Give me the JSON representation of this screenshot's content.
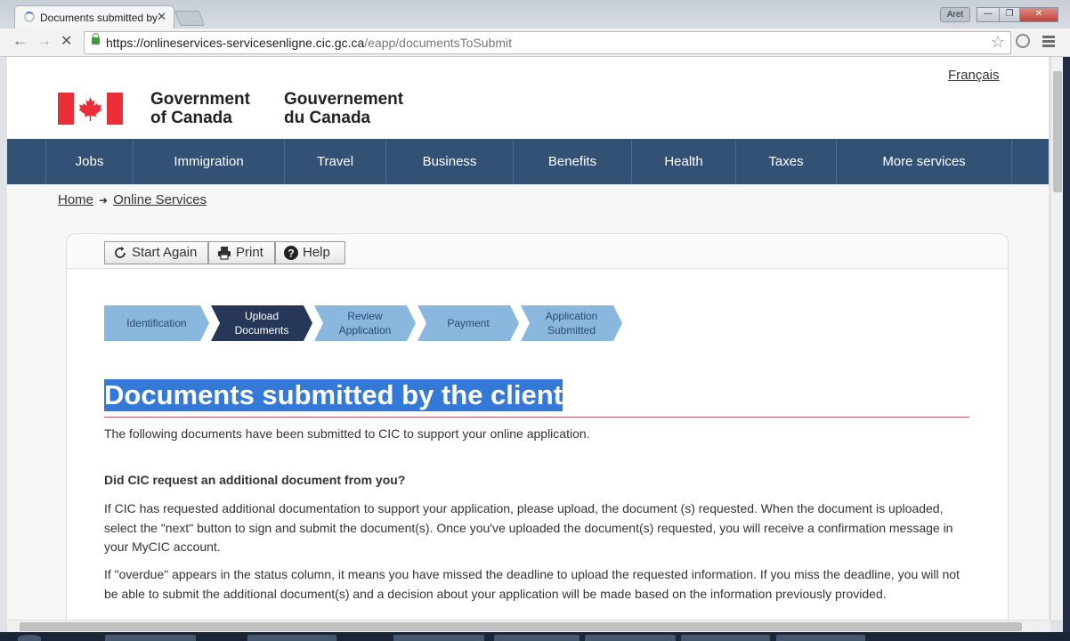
{
  "browser": {
    "tab_title": "Documents submitted by",
    "tab_close": "✕",
    "user_badge": "Aret",
    "url_host": "https://onlineservices-servicesenligne.cic.gc.ca",
    "url_path": "/eapp/documentsToSubmit"
  },
  "header": {
    "language_link": "Français",
    "gov_en_line1": "Government",
    "gov_en_line2": "of Canada",
    "gov_fr_line1": "Gouvernement",
    "gov_fr_line2": "du Canada",
    "flag_colors": {
      "red": "#eb2d37",
      "white": "#ffffff"
    }
  },
  "nav": {
    "items": [
      {
        "label": "Jobs"
      },
      {
        "label": "Immigration"
      },
      {
        "label": "Travel"
      },
      {
        "label": "Business"
      },
      {
        "label": "Benefits"
      },
      {
        "label": "Health"
      },
      {
        "label": "Taxes"
      },
      {
        "label": "More services"
      }
    ],
    "color": "#335075"
  },
  "breadcrumb": {
    "home": "Home",
    "arrow": "➜",
    "current": "Online Services"
  },
  "toolbar": {
    "start_again": "Start Again",
    "print": "Print",
    "help": "Help"
  },
  "steps": [
    {
      "line1": "Identification",
      "line2": "",
      "state": "done"
    },
    {
      "line1": "Upload",
      "line2": "Documents",
      "state": "current"
    },
    {
      "line1": "Review",
      "line2": "Application",
      "state": "todo"
    },
    {
      "line1": "Payment",
      "line2": "",
      "state": "todo"
    },
    {
      "line1": "Application",
      "line2": "Submitted",
      "state": "todo"
    }
  ],
  "content": {
    "heading": "Documents submitted by the client",
    "intro": "The following documents have been submitted to CIC to support your online application.",
    "question": "Did CIC request an additional document from you?",
    "para1": "If CIC has requested additional documentation to support your application, please upload, the document (s) requested. When the document is uploaded, select the \"next\" button to sign and submit the document(s).  Once you've uploaded the document(s) requested, you will receive a confirmation message in your MyCIC account.",
    "para2": "If \"overdue\" appears in the status column, it means you have missed the deadline to upload the requested information. If you miss the deadline, you will not be able to submit the additional document(s) and a decision about your application will be made based on the information previously provided."
  }
}
